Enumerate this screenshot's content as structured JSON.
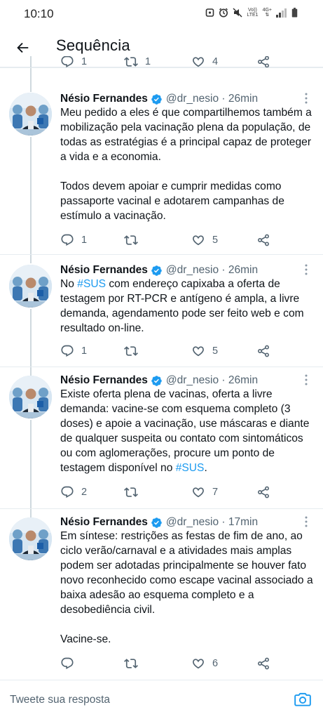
{
  "status_bar": {
    "time": "10:10",
    "net_top": "Vo))",
    "net_bottom": "LTE1",
    "net_type": "4G+"
  },
  "header": {
    "title": "Sequência"
  },
  "partial": {
    "reply_count": "1",
    "retweet_count": "1",
    "like_count": "4"
  },
  "tweets": [
    {
      "name": "Nésio Fernandes",
      "handle": "@dr_nesio · 26min",
      "para1": "Meu pedido a eles é que compartilhemos também a mobilização pela vacinação plena da população, de todas as estratégias é a principal capaz de proteger a vida e a economia.",
      "para2": "Todos devem apoiar e cumprir medidas como passaporte vacinal e adotarem campanhas de estímulo a vacinação.",
      "reply_count": "1",
      "retweet_count": "",
      "like_count": "5"
    },
    {
      "name": "Nésio Fernandes",
      "handle": "@dr_nesio · 26min",
      "pre": "No ",
      "hashtag": "#SUS",
      "post": " com endereço capixaba a oferta de testagem por RT-PCR e antígeno é ampla, a livre demanda, agendamento pode ser feito web e com resultado on-line.",
      "reply_count": "1",
      "retweet_count": "",
      "like_count": "5"
    },
    {
      "name": "Nésio Fernandes",
      "handle": "@dr_nesio · 26min",
      "pre": "Existe oferta plena de vacinas, oferta a livre demanda: vacine-se com esquema completo (3 doses) e apoie a vacinação, use máscaras e diante de qualquer suspeita ou contato com sintomáticos ou com aglomerações, procure um ponto de testagem disponível no ",
      "hashtag": "#SUS",
      "post": ".",
      "reply_count": "2",
      "retweet_count": "",
      "like_count": "7"
    },
    {
      "name": "Nésio Fernandes",
      "handle": "@dr_nesio · 17min",
      "para1": "Em síntese: restrições as festas de fim de ano, ao ciclo verão/carnaval e a atividades mais amplas podem ser adotadas principalmente se houver fato novo reconhecido como escape vacinal associado a baixa adesão ao esquema completo e a desobediência civil.",
      "para2": "Vacine-se.",
      "reply_count": "",
      "retweet_count": "",
      "like_count": "6"
    }
  ],
  "reply_bar": {
    "placeholder": "Tweete sua resposta"
  },
  "colors": {
    "accent": "#1d9bf0",
    "text": "#0f1419",
    "secondary": "#536471",
    "divider": "#e6ecf0"
  }
}
